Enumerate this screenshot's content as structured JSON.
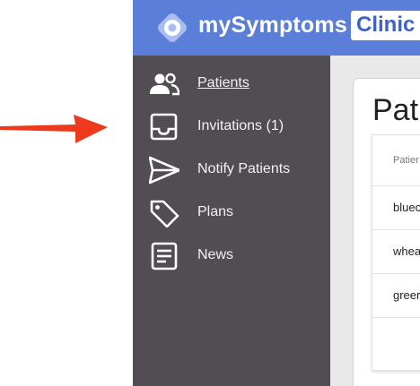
{
  "header": {
    "brand": "mySymptoms",
    "badge": "Clinic",
    "brand_color": "#5b7fd8"
  },
  "sidebar": {
    "background": "#514d52",
    "items": [
      {
        "label": "Patients",
        "icon": "people-icon",
        "active": true
      },
      {
        "label": "Invitations (1)",
        "icon": "inbox-tray-icon",
        "active": false
      },
      {
        "label": "Notify Patients",
        "icon": "send-icon",
        "active": false
      },
      {
        "label": "Plans",
        "icon": "tag-icon",
        "active": false
      },
      {
        "label": "News",
        "icon": "document-icon",
        "active": false
      }
    ]
  },
  "main": {
    "title": "Pati",
    "table": {
      "header": "Patier",
      "rows": [
        "bluec",
        "whea",
        "greer"
      ]
    }
  },
  "annotation": {
    "arrow_color": "#ee3a1c"
  }
}
